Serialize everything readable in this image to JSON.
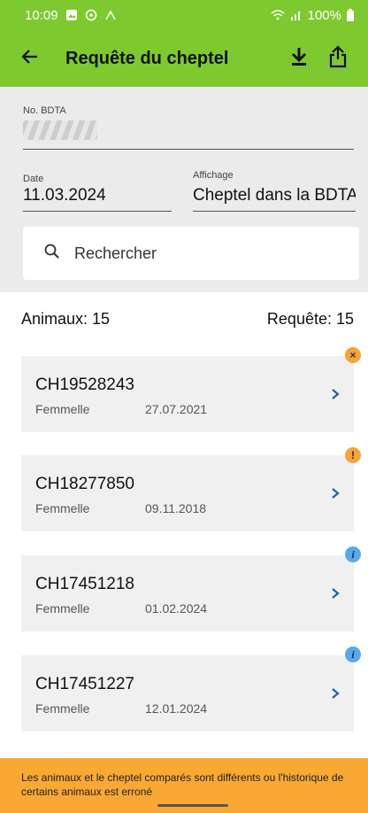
{
  "status_bar": {
    "time": "10:09",
    "battery": "100%"
  },
  "app_bar": {
    "title": "Requête du cheptel",
    "back_icon": "arrow-left-icon",
    "download_icon": "download-icon",
    "share_icon": "share-icon"
  },
  "form": {
    "bdta_label": "No. BDTA",
    "bdta_value": "",
    "date_label": "Date",
    "date_value": "11.03.2024",
    "display_label": "Affichage",
    "display_value": "Cheptel dans la BDTA"
  },
  "search": {
    "placeholder": "Rechercher"
  },
  "counts": {
    "animals": "Animaux: 15",
    "query": "Requête: 15"
  },
  "animals": [
    {
      "id": "CH19528243",
      "sex": "Femmelle",
      "date": "27.07.2021",
      "badge": "error",
      "badge_glyph": "×",
      "badge_color": "#f4a43a"
    },
    {
      "id": "CH18277850",
      "sex": "Femmelle",
      "date": "09.11.2018",
      "badge": "warning",
      "badge_glyph": "!",
      "badge_color": "#f4a43a"
    },
    {
      "id": "CH17451218",
      "sex": "Femmelle",
      "date": "01.02.2024",
      "badge": "info",
      "badge_glyph": "i",
      "badge_color": "#5aa9e6"
    },
    {
      "id": "CH17451227",
      "sex": "Femmelle",
      "date": "12.01.2024",
      "badge": "info",
      "badge_glyph": "i",
      "badge_color": "#5aa9e6"
    }
  ],
  "banner": {
    "text": "Les animaux et le cheptel comparés sont différents ou l'historique de certains animaux est erroné"
  },
  "colors": {
    "accent": "#7ec92f",
    "banner": "#f9a834",
    "chevron": "#1f5ea8"
  }
}
